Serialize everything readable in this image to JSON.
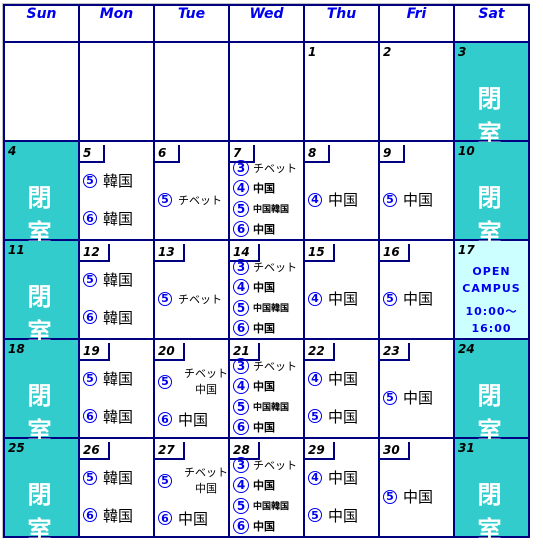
{
  "calendar": {
    "weekdays": [
      "Sun",
      "Mon",
      "Tue",
      "Wed",
      "Thu",
      "Fri",
      "Sat"
    ],
    "closed_label": "閉室",
    "colors": {
      "border": "#000080",
      "weekday_text": "#0000ee",
      "closed_bg": "#33cccc",
      "event_bg": "#ccffff",
      "mark_color": "#0000ee"
    },
    "weeks": [
      [
        {
          "day": ""
        },
        {
          "day": ""
        },
        {
          "day": ""
        },
        {
          "day": ""
        },
        {
          "day": "1"
        },
        {
          "day": "2"
        },
        {
          "day": "3",
          "closed": true
        }
      ],
      [
        {
          "day": "4",
          "closed": true
        },
        {
          "day": "5",
          "entries": [
            {
              "mark": "5",
              "text": "韓国"
            },
            {
              "mark": "6",
              "text": "韓国"
            }
          ]
        },
        {
          "day": "6",
          "entries": [
            {
              "mark": "5",
              "text": "チベット"
            }
          ]
        },
        {
          "day": "7",
          "entries": [
            {
              "mark": "3",
              "text": "チベット"
            },
            {
              "mark": "4",
              "text": "中国"
            },
            {
              "mark": "5",
              "text": "中国韓国"
            },
            {
              "mark": "6",
              "text": "中国"
            }
          ]
        },
        {
          "day": "8",
          "entries": [
            {
              "mark": "4",
              "text": "中国"
            }
          ]
        },
        {
          "day": "9",
          "entries": [
            {
              "mark": "5",
              "text": "中国"
            }
          ]
        },
        {
          "day": "10",
          "closed": true
        }
      ],
      [
        {
          "day": "11",
          "closed": true
        },
        {
          "day": "12",
          "entries": [
            {
              "mark": "5",
              "text": "韓国"
            },
            {
              "mark": "6",
              "text": "韓国"
            }
          ]
        },
        {
          "day": "13",
          "entries": [
            {
              "mark": "5",
              "text": "チベット"
            }
          ]
        },
        {
          "day": "14",
          "entries": [
            {
              "mark": "3",
              "text": "チベット"
            },
            {
              "mark": "4",
              "text": "中国"
            },
            {
              "mark": "5",
              "text": "中国韓国"
            },
            {
              "mark": "6",
              "text": "中国"
            }
          ]
        },
        {
          "day": "15",
          "entries": [
            {
              "mark": "4",
              "text": "中国"
            }
          ]
        },
        {
          "day": "16",
          "entries": [
            {
              "mark": "5",
              "text": "中国"
            }
          ]
        },
        {
          "day": "17",
          "event": {
            "line1": "OPEN",
            "line2": "CAMPUS",
            "line3": "10:00～",
            "line4": "16:00"
          }
        }
      ],
      [
        {
          "day": "18",
          "closed": true
        },
        {
          "day": "19",
          "entries": [
            {
              "mark": "5",
              "text": "韓国"
            },
            {
              "mark": "6",
              "text": "韓国"
            }
          ]
        },
        {
          "day": "20",
          "entries": [
            {
              "mark": "5",
              "text": "チベット",
              "text2": "中国"
            },
            {
              "mark": "6",
              "text": "中国"
            }
          ]
        },
        {
          "day": "21",
          "entries": [
            {
              "mark": "3",
              "text": "チベット"
            },
            {
              "mark": "4",
              "text": "中国"
            },
            {
              "mark": "5",
              "text": "中国韓国"
            },
            {
              "mark": "6",
              "text": "中国"
            }
          ]
        },
        {
          "day": "22",
          "entries": [
            {
              "mark": "4",
              "text": "中国"
            },
            {
              "mark": "5",
              "text": "中国"
            }
          ]
        },
        {
          "day": "23",
          "entries": [
            {
              "mark": "5",
              "text": "中国"
            }
          ]
        },
        {
          "day": "24",
          "closed": true
        }
      ],
      [
        {
          "day": "25",
          "closed": true
        },
        {
          "day": "26",
          "entries": [
            {
              "mark": "5",
              "text": "韓国"
            },
            {
              "mark": "6",
              "text": "韓国"
            }
          ]
        },
        {
          "day": "27",
          "entries": [
            {
              "mark": "5",
              "text": "チベット",
              "text2": "中国"
            },
            {
              "mark": "6",
              "text": "中国"
            }
          ]
        },
        {
          "day": "28",
          "entries": [
            {
              "mark": "3",
              "text": "チベット"
            },
            {
              "mark": "4",
              "text": "中国"
            },
            {
              "mark": "5",
              "text": "中国韓国"
            },
            {
              "mark": "6",
              "text": "中国"
            }
          ]
        },
        {
          "day": "29",
          "entries": [
            {
              "mark": "4",
              "text": "中国"
            },
            {
              "mark": "5",
              "text": "中国"
            }
          ]
        },
        {
          "day": "30",
          "entries": [
            {
              "mark": "5",
              "text": "中国"
            }
          ]
        },
        {
          "day": "31",
          "closed": true
        }
      ]
    ]
  }
}
